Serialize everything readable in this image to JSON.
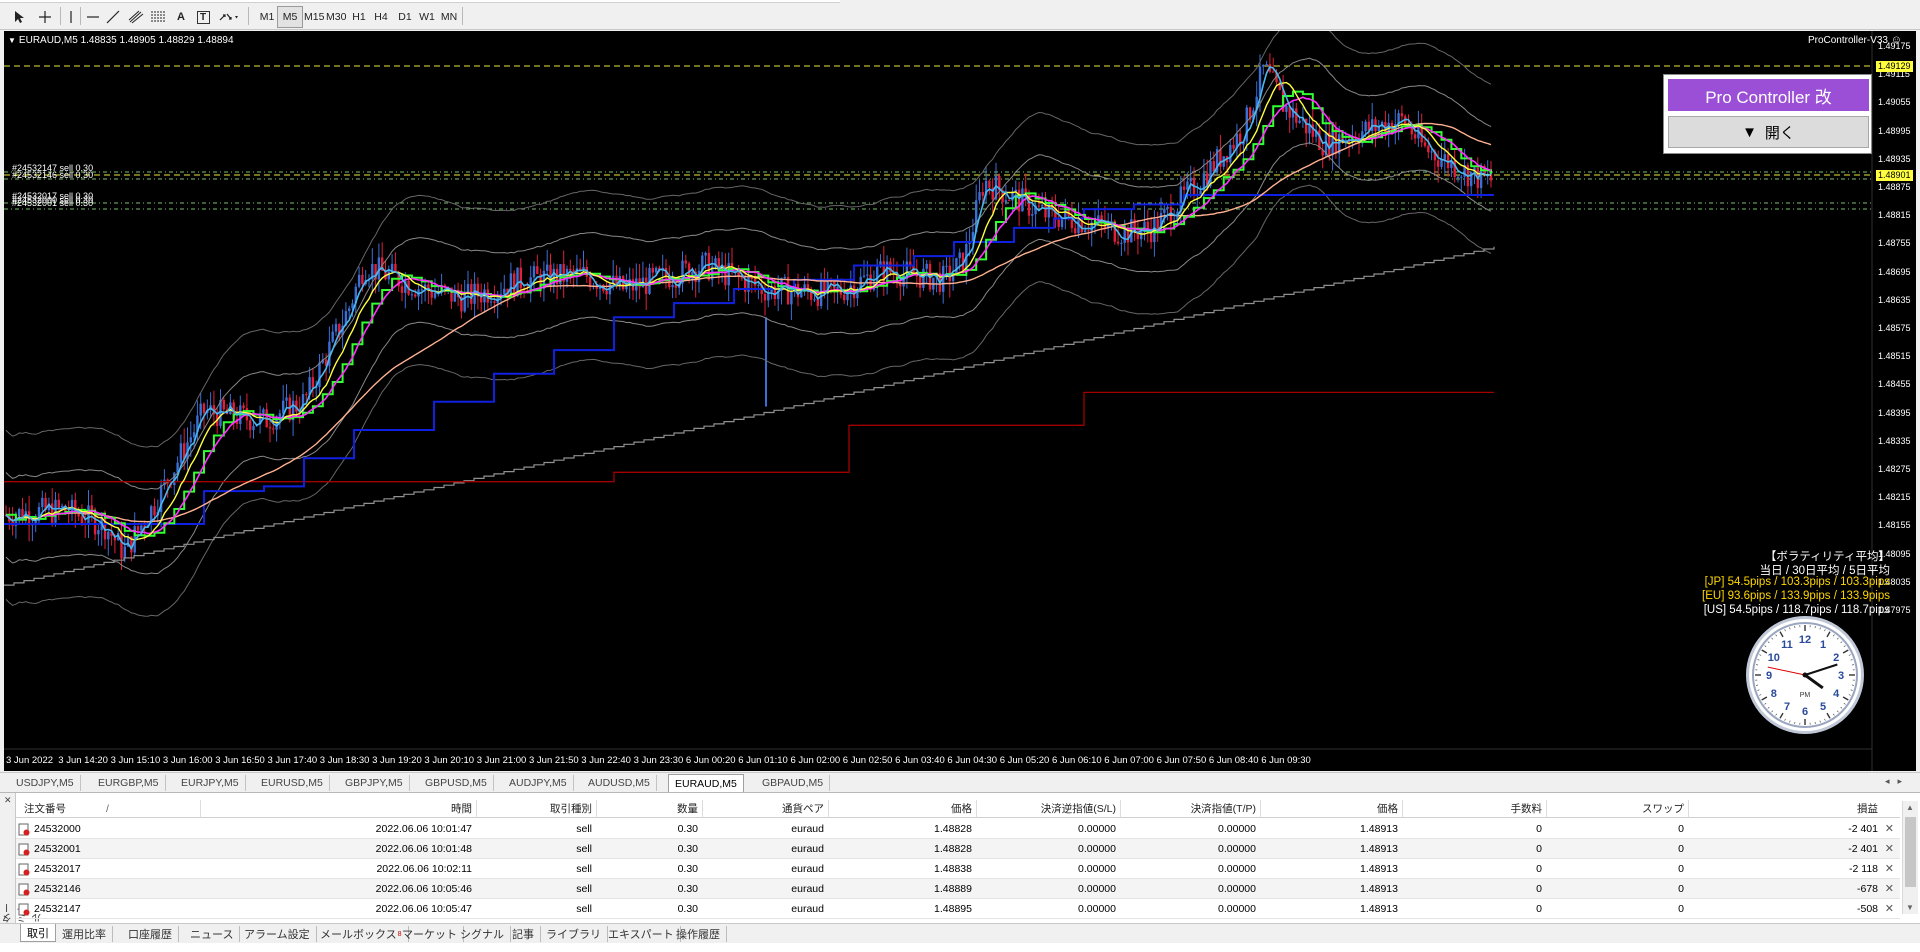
{
  "toolbar": {
    "timeframes": [
      "M1",
      "M5",
      "M15",
      "M30",
      "H1",
      "H4",
      "D1",
      "W1",
      "MN"
    ],
    "active_timeframe": "M5",
    "icons": [
      "cursor-icon",
      "crosshair-icon",
      "vertical-line-icon",
      "horizontal-line-icon",
      "trend-line-icon",
      "equidistant-channel-icon",
      "fibonacci-icon",
      "text-icon",
      "text-label-icon",
      "arrows-icon"
    ],
    "text_icon_label": "A",
    "text_label_icon_label": "T"
  },
  "chart": {
    "title": "EURAUD,M5  1.48835 1.48905 1.48829 1.48894",
    "indicator_label": "ProController-V33",
    "background": "#000000",
    "price_ticks": [
      "1.49175",
      "1.49115",
      "1.49055",
      "1.48995",
      "1.48935",
      "1.48875",
      "1.48815",
      "1.48755",
      "1.48695",
      "1.48635",
      "1.48575",
      "1.48515",
      "1.48455",
      "1.48395",
      "1.48335",
      "1.48275",
      "1.48215",
      "1.48155",
      "1.48095",
      "1.48035",
      "1.47975"
    ],
    "price_tag_top": "1.49129",
    "price_tag_current": "1.48901",
    "time_ticks": [
      "3 Jun 2022",
      "3 Jun 14:20",
      "3 Jun 15:10",
      "3 Jun 16:00",
      "3 Jun 16:50",
      "3 Jun 17:40",
      "3 Jun 18:30",
      "3 Jun 19:20",
      "3 Jun 20:10",
      "3 Jun 21:00",
      "3 Jun 21:50",
      "3 Jun 22:40",
      "3 Jun 23:30",
      "6 Jun 00:20",
      "6 Jun 01:10",
      "6 Jun 02:00",
      "6 Jun 02:50",
      "6 Jun 03:40",
      "6 Jun 04:30",
      "6 Jun 05:20",
      "6 Jun 06:10",
      "6 Jun 07:00",
      "6 Jun 07:50",
      "6 Jun 08:40",
      "6 Jun 09:30"
    ],
    "order_lines": [
      "#24532147 sell 0.30",
      "#24532146 sell 0.30",
      "#24532017 sell 0.30",
      "#24532000 sell 0.30",
      "#24532001 sell 0.30"
    ],
    "stats": {
      "header": "【ボラティリティ平均】",
      "subheader": "当日 / 30日平均 / 5日平均",
      "lines": [
        {
          "text": "[JP] 54.5pips / 103.3pips / 103.3pips",
          "color": "#ffd700"
        },
        {
          "text": "[EU] 93.6pips / 133.9pips / 133.9pips",
          "color": "#ffd700"
        },
        {
          "text": "[US] 54.5pips / 118.7pips / 118.7pips",
          "color": "#ffffff"
        }
      ]
    },
    "colors": {
      "bull": "#3b6fd6",
      "bear": "#e0203a",
      "ema_fast": "#4ab8f0",
      "ema_mid": "#ffff40",
      "ema_slow": "#ff30ff",
      "step_green": "#30ff30",
      "ma_long": "#ffb090",
      "blue_step": "#1020e0",
      "dark_red_step": "#a00000",
      "grey_step": "#909090"
    }
  },
  "pro_controller": {
    "title": "Pro Controller 改",
    "open_label": "開く",
    "open_arrow": "▼"
  },
  "clock": {
    "am_pm": "PM",
    "numbers": [
      "12",
      "1",
      "2",
      "3",
      "4",
      "5",
      "6",
      "7",
      "8",
      "9",
      "10",
      "11"
    ]
  },
  "symbol_tabs": [
    "USDJPY,M5",
    "EURGBP,M5",
    "EURJPY,M5",
    "EURUSD,M5",
    "GBPJPY,M5",
    "GBPUSD,M5",
    "AUDJPY,M5",
    "AUDUSD,M5",
    "EURAUD,M5",
    "GBPAUD,M5"
  ],
  "active_symbol_tab": "EURAUD,M5",
  "terminal": {
    "side_label": "ターミナル",
    "columns": [
      "注文番号",
      "時間",
      "取引種別",
      "数量",
      "通貨ペア",
      "価格",
      "決済逆指値(S/L)",
      "決済指値(T/P)",
      "価格",
      "手数料",
      "スワップ",
      "損益"
    ],
    "sort_marker": "/",
    "rows": [
      [
        "24532000",
        "2022.06.06 10:01:47",
        "sell",
        "0.30",
        "euraud",
        "1.48828",
        "0.00000",
        "0.00000",
        "1.48913",
        "0",
        "0",
        "-2 401"
      ],
      [
        "24532001",
        "2022.06.06 10:01:48",
        "sell",
        "0.30",
        "euraud",
        "1.48828",
        "0.00000",
        "0.00000",
        "1.48913",
        "0",
        "0",
        "-2 401"
      ],
      [
        "24532017",
        "2022.06.06 10:02:11",
        "sell",
        "0.30",
        "euraud",
        "1.48838",
        "0.00000",
        "0.00000",
        "1.48913",
        "0",
        "0",
        "-2 118"
      ],
      [
        "24532146",
        "2022.06.06 10:05:46",
        "sell",
        "0.30",
        "euraud",
        "1.48889",
        "0.00000",
        "0.00000",
        "1.48913",
        "0",
        "0",
        "-678"
      ],
      [
        "24532147",
        "2022.06.06 10:05:47",
        "sell",
        "0.30",
        "euraud",
        "1.48895",
        "0.00000",
        "0.00000",
        "1.48913",
        "0",
        "0",
        "-508"
      ]
    ],
    "bottom_tabs": [
      "取引",
      "運用比率",
      "口座履歴",
      "ニュース",
      "アラーム設定",
      "メールボックス",
      "マーケット",
      "シグナル",
      "記事",
      "ライブラリ",
      "エキスパート",
      "操作履歴"
    ],
    "mailbox_badge": "8",
    "active_bottom_tab": "取引"
  }
}
